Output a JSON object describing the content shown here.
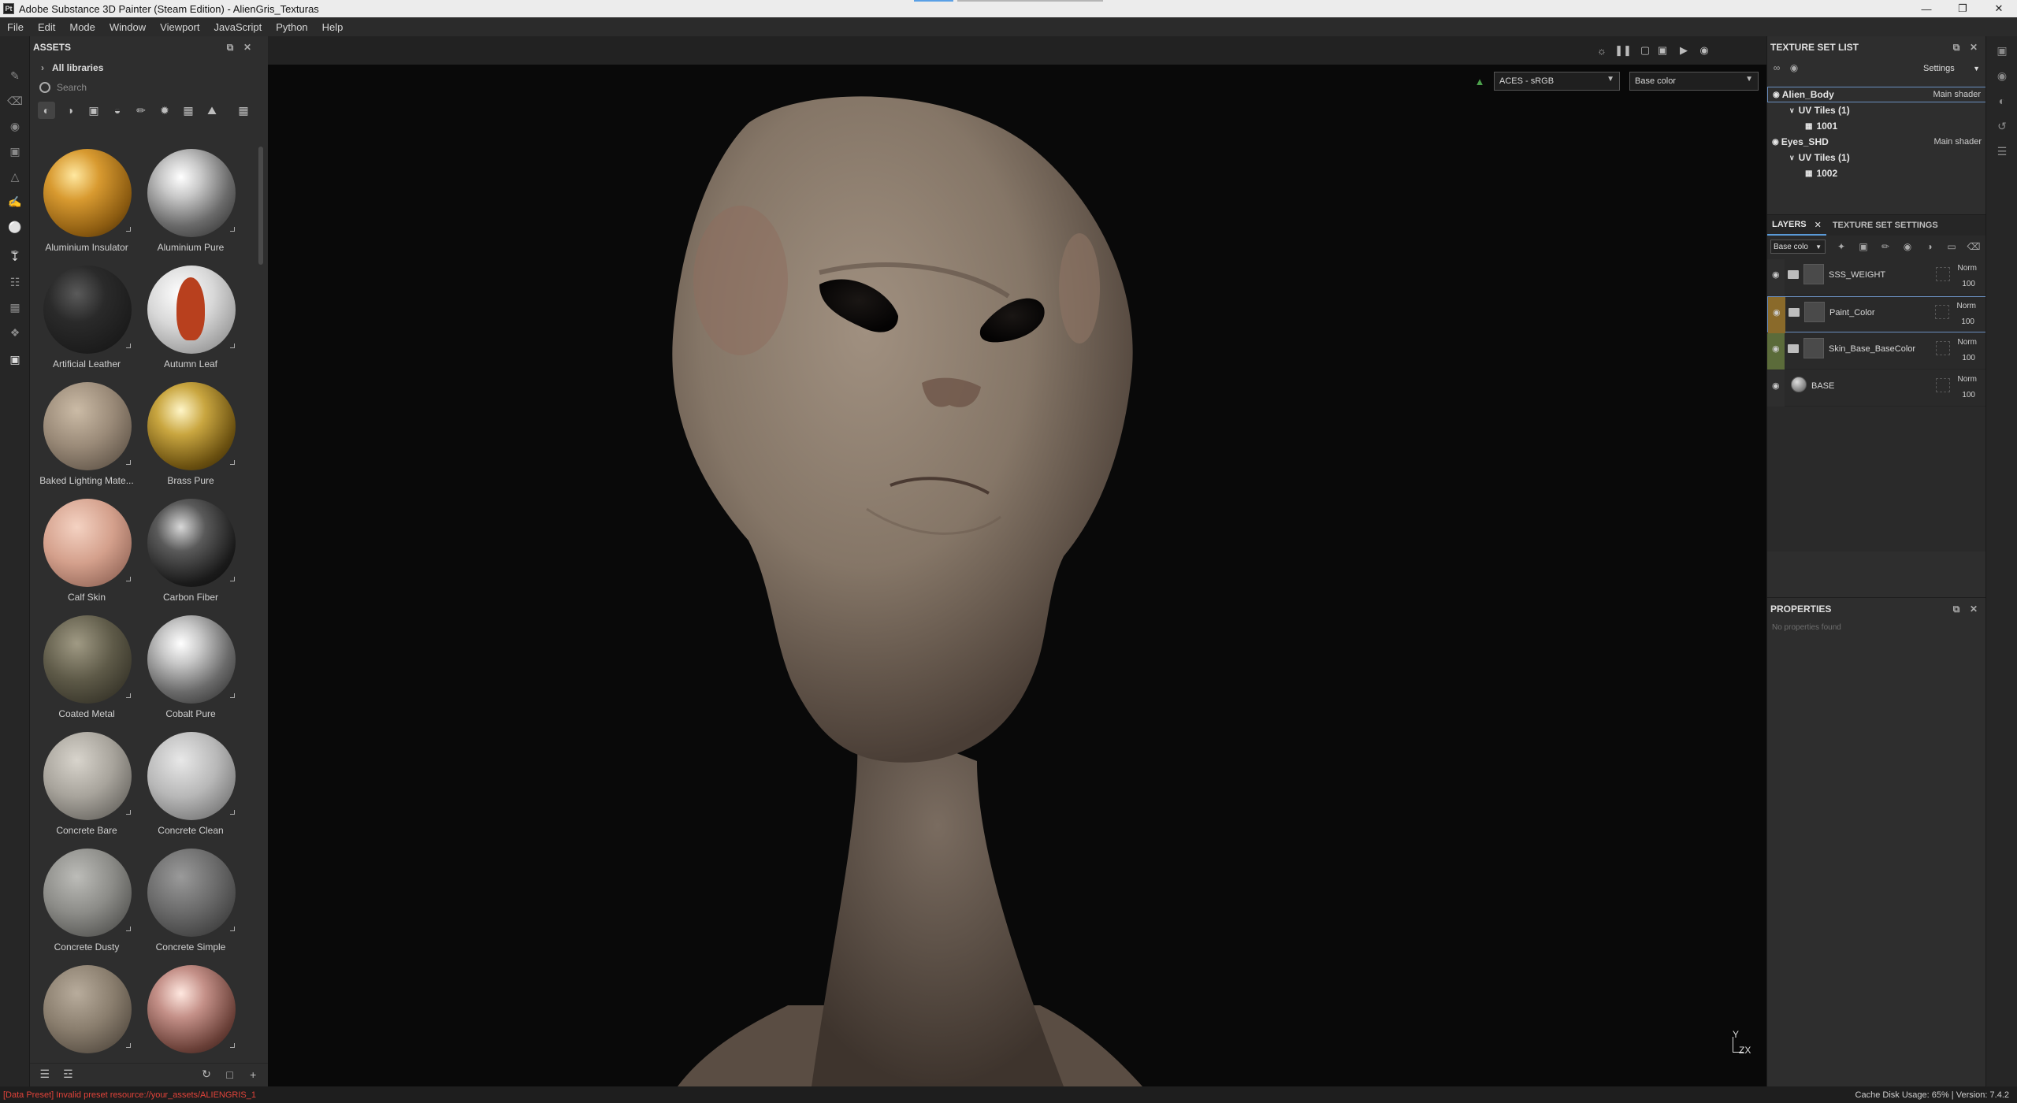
{
  "window": {
    "title": "Adobe Substance 3D Painter (Steam Edition) - AlienGris_Texturas",
    "app_icon": "Pt",
    "controls": [
      "minimize-icon",
      "maximize-icon",
      "close-icon"
    ]
  },
  "menu": [
    "File",
    "Edit",
    "Mode",
    "Window",
    "Viewport",
    "JavaScript",
    "Python",
    "Help"
  ],
  "assets": {
    "title": "ASSETS",
    "library": "All libraries",
    "search_placeholder": "Search",
    "filters": [
      "materials",
      "smart-materials",
      "textures",
      "filters",
      "brushes",
      "particles",
      "environments",
      "procedurals",
      "grid-view"
    ],
    "items": [
      {
        "name": "Aluminium Insulator",
        "style": "gold-hex"
      },
      {
        "name": "Aluminium Pure",
        "style": "chrome"
      },
      {
        "name": "Artificial Leather",
        "style": "black"
      },
      {
        "name": "Autumn Leaf",
        "style": "leaf"
      },
      {
        "name": "Baked Lighting Mate...",
        "style": "beige"
      },
      {
        "name": "Brass Pure",
        "style": "brass"
      },
      {
        "name": "Calf Skin",
        "style": "skin"
      },
      {
        "name": "Carbon Fiber",
        "style": "carbon"
      },
      {
        "name": "Coated Metal",
        "style": "coated"
      },
      {
        "name": "Cobalt Pure",
        "style": "chrome"
      },
      {
        "name": "Concrete Bare",
        "style": "concrete1"
      },
      {
        "name": "Concrete Clean",
        "style": "concrete2"
      },
      {
        "name": "Concrete Dusty",
        "style": "concrete3"
      },
      {
        "name": "Concrete Simple",
        "style": "concrete4"
      },
      {
        "name": "",
        "style": "taupe"
      },
      {
        "name": "",
        "style": "copper"
      }
    ]
  },
  "viewport": {
    "colorspace": "ACES - sRGB",
    "channel": "Base color",
    "axis_y": "Y",
    "axis_zx": "ZX"
  },
  "texture_set_list": {
    "title": "TEXTURE SET LIST",
    "settings_label": "Settings",
    "rows": [
      {
        "name": "Alien_Body",
        "shader": "Main shader",
        "level": 0
      },
      {
        "name": "UV Tiles (1)",
        "shader": "",
        "level": 1
      },
      {
        "name": "1001",
        "shader": "",
        "level": 2
      },
      {
        "name": "Eyes_SHD",
        "shader": "Main shader",
        "level": 0
      },
      {
        "name": "UV Tiles (1)",
        "shader": "",
        "level": 1
      },
      {
        "name": "1002",
        "shader": "",
        "level": 2
      }
    ]
  },
  "layers": {
    "tab_layers": "LAYERS",
    "tab_texture_settings": "TEXTURE SET SETTINGS",
    "channel_select": "Base colo",
    "rows": [
      {
        "name": "SSS_WEIGHT",
        "blend": "Norm",
        "opacity": "100",
        "color": "#2e2e2e"
      },
      {
        "name": "Paint_Color",
        "blend": "Norm",
        "opacity": "100",
        "color": "#8a6a2a"
      },
      {
        "name": "Skin_Base_BaseColor",
        "blend": "Norm",
        "opacity": "100",
        "color": "#5b6b3a"
      },
      {
        "name": "BASE",
        "blend": "Norm",
        "opacity": "100",
        "color": "#2e2e2e"
      }
    ]
  },
  "properties": {
    "title": "PROPERTIES",
    "empty_text": "No properties found"
  },
  "status": {
    "error": "[Data Preset] Invalid preset resource://your_assets/ALIENGRIS_1",
    "cache": "Cache Disk Usage:   65% | Version: 7.4.2"
  }
}
